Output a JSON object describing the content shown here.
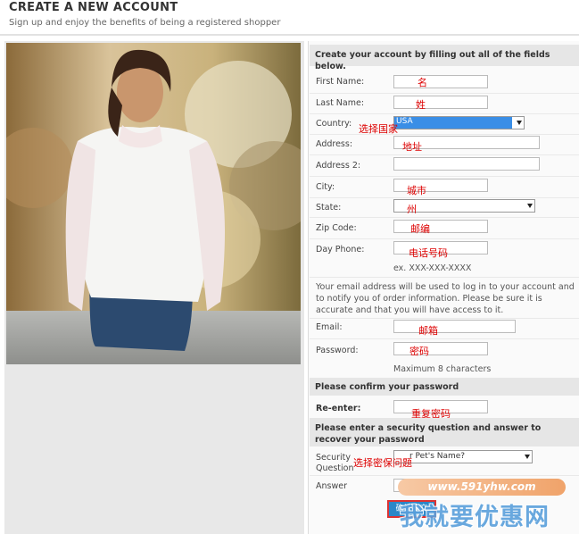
{
  "header": {
    "title": "CREATE A NEW ACCOUNT",
    "subtitle": "Sign up and enjoy the benefits of being a registered shopper"
  },
  "form": {
    "intro": "Create your account by filling out all of the fields below.",
    "fields": {
      "first_name": {
        "label": "First Name:",
        "annotation": "名"
      },
      "last_name": {
        "label": "Last Name:",
        "annotation": "姓"
      },
      "country": {
        "label": "Country:",
        "value": "USA",
        "annotation": "选择国家"
      },
      "address": {
        "label": "Address:",
        "annotation": "地址"
      },
      "address2": {
        "label": "Address 2:"
      },
      "city": {
        "label": "City:",
        "annotation": "城市"
      },
      "state": {
        "label": "State:",
        "annotation": "州"
      },
      "zip": {
        "label": "Zip Code:",
        "annotation": "邮编"
      },
      "phone": {
        "label": "Day Phone:",
        "annotation": "电话号码",
        "hint": "ex. XXX-XXX-XXXX"
      },
      "email": {
        "label": "Email:",
        "annotation": "邮箱"
      },
      "password": {
        "label": "Password:",
        "annotation": "密码",
        "hint": "Maximum 8 characters"
      },
      "reenter": {
        "label": "Re-enter:",
        "annotation": "重复密码"
      },
      "security_question": {
        "label_line1": "Security",
        "label_line2": "Question",
        "value": "r Pet's Name?",
        "annotation": "选择密保问题"
      },
      "answer": {
        "label": "Answer"
      }
    },
    "email_note": "Your email address will be used to log in to your account and to notify you of order information. Please be sure it is accurate and that you will have access to it.",
    "confirm_section": "Please confirm your password",
    "security_section": "Please enter a security question and answer to recover your password",
    "submit_label": "确认提交"
  },
  "watermark": {
    "url": "www.591yhw.com",
    "text": "我就要优惠网"
  }
}
